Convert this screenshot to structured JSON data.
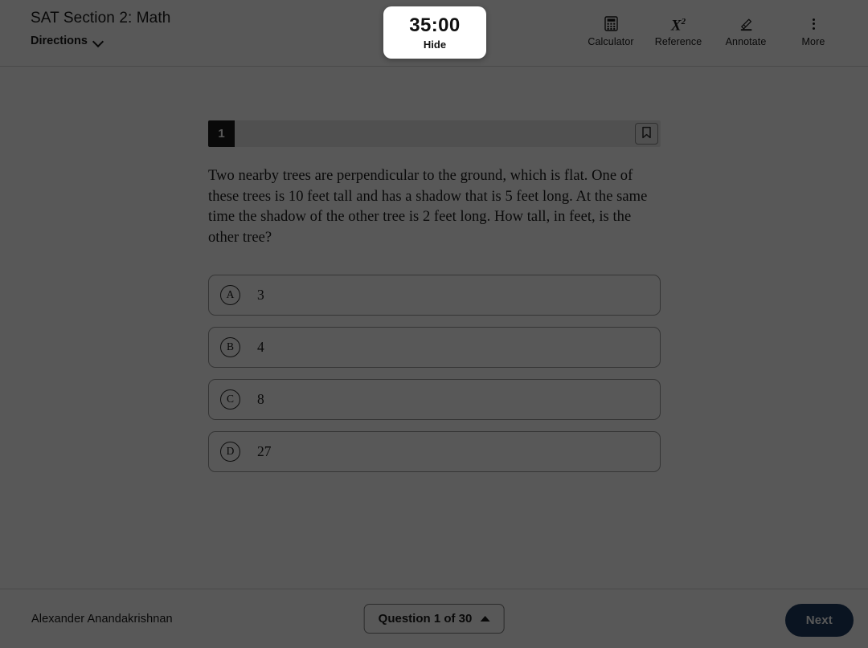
{
  "header": {
    "section_title": "SAT Section 2: Math",
    "directions_label": "Directions",
    "directions_icon": "chevron-down-icon"
  },
  "timer": {
    "value": "35:00",
    "hide_label": "Hide"
  },
  "toolbar": {
    "items": [
      {
        "label": "Calculator",
        "icon": "calculator-icon"
      },
      {
        "label": "Reference",
        "icon": "x-squared-icon",
        "glyph_base": "X",
        "glyph_sup": "2"
      },
      {
        "label": "Annotate",
        "icon": "highlighter-pen-icon"
      },
      {
        "label": "More",
        "icon": "more-vertical-dots-icon"
      }
    ]
  },
  "question": {
    "number": "1",
    "bookmark_icon": "bookmark-icon",
    "text": "Two nearby trees are perpendicular to the ground, which is flat. One of these trees is 10 feet tall and has a shadow that is 5 feet long. At the same time the shadow of the other tree is 2 feet long. How tall, in feet, is the other tree?",
    "choices": [
      {
        "letter": "A",
        "text": "3"
      },
      {
        "letter": "B",
        "text": "4"
      },
      {
        "letter": "C",
        "text": "8"
      },
      {
        "letter": "D",
        "text": "27"
      }
    ]
  },
  "footer": {
    "student_name": "Alexander Anandakrishnan",
    "question_nav_label": "Question 1 of 30",
    "question_nav_icon": "triangle-up-icon",
    "next_label": "Next"
  },
  "colors": {
    "next_button": "#1e3a5f",
    "question_badge": "#1a1a1a",
    "question_header_bar": "#e9e9e9",
    "text_primary": "#1a1a1a",
    "page_background": "#ffffff",
    "scrim_brightness": "0.345"
  }
}
